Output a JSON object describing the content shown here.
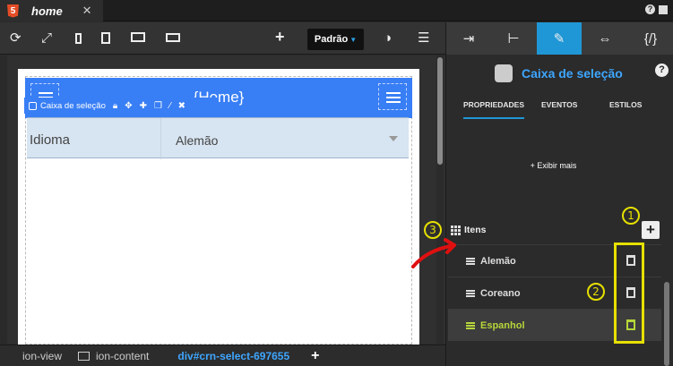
{
  "tab": {
    "title": "home",
    "close": "✕",
    "html5": "5"
  },
  "top_right": {
    "help": "?"
  },
  "toolbar": {
    "padrao_label": "Padrão",
    "add": "+"
  },
  "canvas": {
    "header_title": "{Home}",
    "select_breadcrumb": "Caixa de seleção",
    "item_label": "Idioma",
    "item_value": "Alemão"
  },
  "statusbar": {
    "view": "ion-view",
    "content": "ion-content",
    "active": "div#crn-select-697655",
    "add": "+"
  },
  "right_panel": {
    "component_title": "Caixa de seleção",
    "help": "?",
    "tabs": [
      "PROPRIEDADES",
      "EVENTOS",
      "ESTILOS"
    ],
    "show_more": "+ Exibir mais",
    "items_header": "Itens",
    "add": "+",
    "items": [
      {
        "label": "Alemão"
      },
      {
        "label": "Coreano"
      },
      {
        "label": "Espanhol"
      }
    ]
  },
  "annotations": {
    "one": "1",
    "two": "2",
    "three": "3"
  },
  "colors": {
    "accent": "#1f97d6",
    "ionic_blue": "#387ef5",
    "highlight": "#e6e000",
    "selected_text": "#b6d63a"
  }
}
